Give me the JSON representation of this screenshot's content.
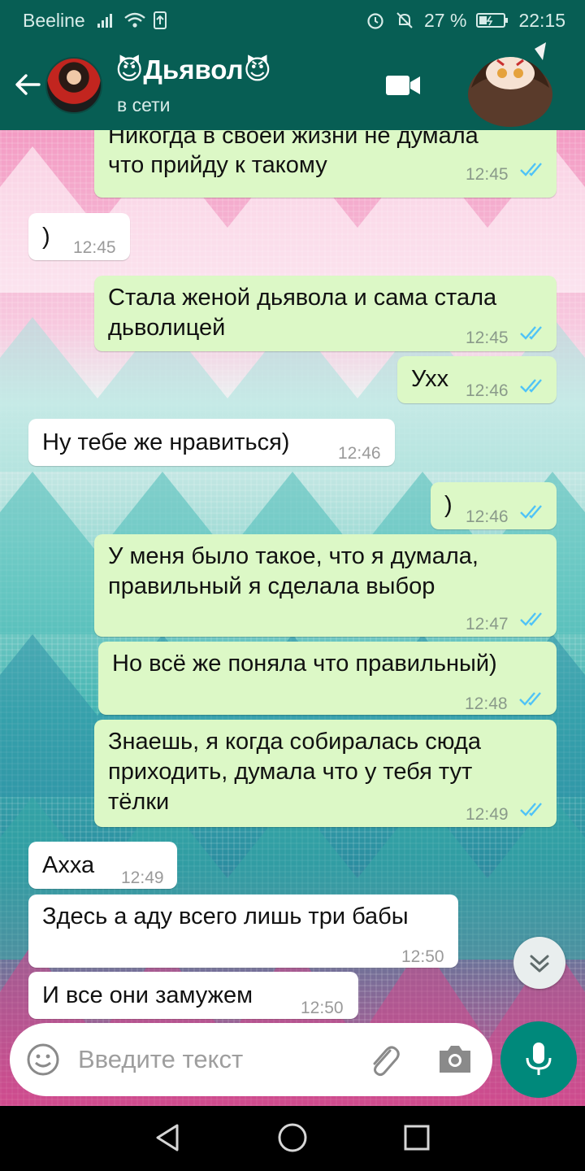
{
  "status_bar": {
    "carrier": "Beeline",
    "battery": "27 %",
    "time": "22:15"
  },
  "header": {
    "contact_name": "😈Дьявол😈",
    "contact_status": "в сети"
  },
  "messages": [
    {
      "dir": "out",
      "lines": [
        "Никогда в своей жизни не думала",
        "что прийду к такому"
      ],
      "time": "12:45",
      "read": true
    },
    {
      "dir": "in",
      "lines": [
        ")"
      ],
      "time": "12:45"
    },
    {
      "dir": "out",
      "lines": [
        "Стала женой дьявола и сама стала",
        "дьволицей"
      ],
      "time": "12:45",
      "read": true
    },
    {
      "dir": "out",
      "lines": [
        "Ухх"
      ],
      "time": "12:46",
      "read": true
    },
    {
      "dir": "in",
      "lines": [
        "Ну тебе же нравиться)"
      ],
      "time": "12:46"
    },
    {
      "dir": "out",
      "lines": [
        ")"
      ],
      "time": "12:46",
      "read": true
    },
    {
      "dir": "out",
      "lines": [
        "У меня было такое, что я думала,",
        "правильный я сделала выбор"
      ],
      "time": "12:47",
      "read": true
    },
    {
      "dir": "out",
      "lines": [
        "Но всё же поняла что правильный)"
      ],
      "time": "12:48",
      "read": true
    },
    {
      "dir": "out",
      "lines": [
        "Знаешь, я когда собиралась сюда",
        "приходить, думала что у тебя тут",
        "тёлки"
      ],
      "time": "12:49",
      "read": true
    },
    {
      "dir": "in",
      "lines": [
        "Ахха"
      ],
      "time": "12:49"
    },
    {
      "dir": "in",
      "lines": [
        "Здесь а аду всего лишь три бабы"
      ],
      "time": "12:50"
    },
    {
      "dir": "in",
      "lines": [
        "И все они замужем"
      ],
      "time": "12:50"
    }
  ],
  "composer": {
    "placeholder": "Введите текст"
  },
  "colors": {
    "header": "#075e54",
    "outgoing_bubble": "#dcf8c6",
    "incoming_bubble": "#ffffff",
    "read_ticks": "#4fc3f7",
    "mic": "#00897b"
  },
  "icons": [
    "back-arrow-icon",
    "video-call-icon",
    "emoji-icon",
    "attach-icon",
    "camera-icon",
    "mic-icon",
    "scroll-down-icon",
    "nav-back-icon",
    "nav-home-icon",
    "nav-recents-icon"
  ]
}
